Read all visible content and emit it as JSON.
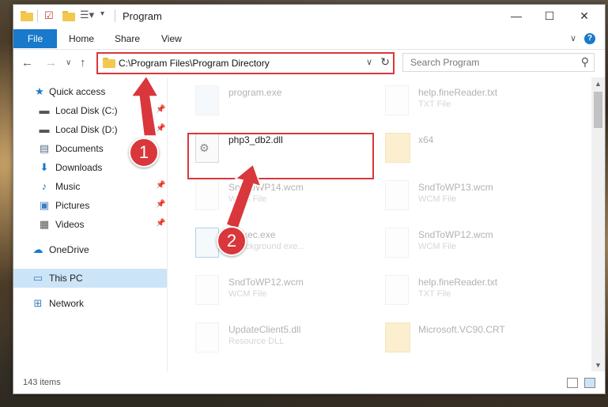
{
  "window": {
    "title": "Program"
  },
  "ribbon": {
    "file": "File",
    "home": "Home",
    "share": "Share",
    "view": "View"
  },
  "address": {
    "path": "C:\\Program Files\\Program Directory"
  },
  "search": {
    "placeholder": "Search Program"
  },
  "nav": [
    {
      "label": "Quick access"
    },
    {
      "label": "Local Disk (C:)"
    },
    {
      "label": "Local Disk (D:)"
    },
    {
      "label": "Documents"
    },
    {
      "label": "Downloads"
    },
    {
      "label": "Music"
    },
    {
      "label": "Pictures"
    },
    {
      "label": "Videos"
    },
    {
      "label": "OneDrive"
    },
    {
      "label": "This PC"
    },
    {
      "label": "Network"
    }
  ],
  "files": [
    {
      "name": "program.exe",
      "type": ""
    },
    {
      "name": "help.fineReader.txt",
      "type": "TXT File"
    },
    {
      "name": "php3_db2.dll",
      "type": ""
    },
    {
      "name": "x64",
      "type": ""
    },
    {
      "name": "SndToWP14.wcm",
      "type": "WCM File"
    },
    {
      "name": "SndToWP13.wcm",
      "type": "WCM File"
    },
    {
      "name": "...Exec.exe",
      "type": "...background exe..."
    },
    {
      "name": "SndToWP12.wcm",
      "type": "WCM File"
    },
    {
      "name": "SndToWP12.wcm",
      "type": "WCM File"
    },
    {
      "name": "help.fineReader.txt",
      "type": "TXT File"
    },
    {
      "name": "UpdateClient5.dll",
      "type": "Resource DLL"
    },
    {
      "name": "Microsoft.VC90.CRT",
      "type": ""
    }
  ],
  "status": {
    "items": "143 items"
  },
  "annotations": {
    "step1": "1",
    "step2": "2"
  },
  "colors": {
    "highlight": "#d9373b",
    "accent": "#1979ca",
    "selected": "#cce4f7"
  }
}
